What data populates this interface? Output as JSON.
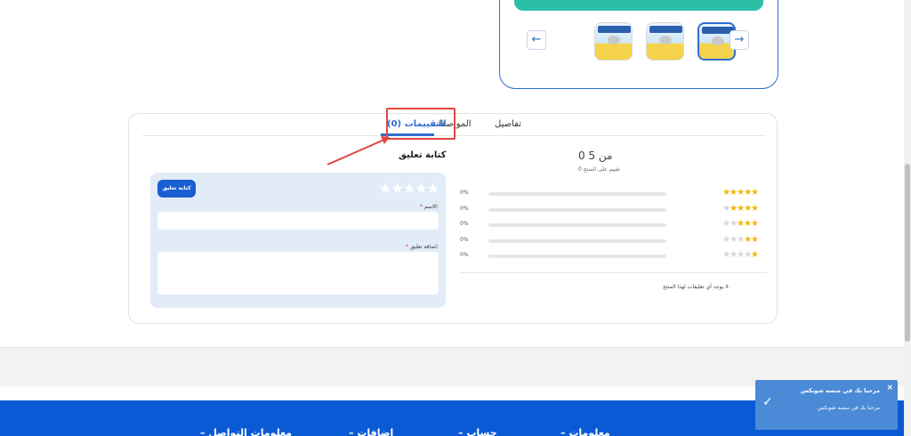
{
  "gallery": {
    "prev_arrow": "←",
    "next_arrow": "→",
    "thumbnails": [
      "product-thumb",
      "product-thumb",
      "product-thumb"
    ]
  },
  "tabs": {
    "details": "تفاصيل",
    "specs": "المواصفات",
    "reviews": "التقييمات (0)"
  },
  "summary": {
    "score": "0 من 5",
    "count_text": "0 تقييم على المنتج",
    "rows": [
      {
        "pct": "0%",
        "stars": 5
      },
      {
        "pct": "0%",
        "stars": 4
      },
      {
        "pct": "0%",
        "stars": 3
      },
      {
        "pct": "0%",
        "stars": 2
      },
      {
        "pct": "0%",
        "stars": 1
      }
    ],
    "no_comments": "لا يوجد أي تعليقات لهذا المنتج."
  },
  "form": {
    "title": "كتابة تعليق",
    "submit": "كتابة تعليق",
    "name_label": "الاسم:",
    "comment_label": "اضافة تعليق:",
    "required_mark": "*"
  },
  "footer": {
    "headings": [
      "– معلومات",
      "– حساب",
      "– إضافات",
      "– معلومات التواصل"
    ]
  },
  "toast": {
    "title": "مرحبا بك في منصه شوبكس",
    "message": "مرحبا بك في منصه شوبكس",
    "close": "×",
    "check": "✓"
  },
  "colors": {
    "accent": "#2f6fd1",
    "star": "#f5b400",
    "highlight": "#e0463f",
    "footer": "#0a5ad6",
    "toast": "#4b8ad6"
  }
}
